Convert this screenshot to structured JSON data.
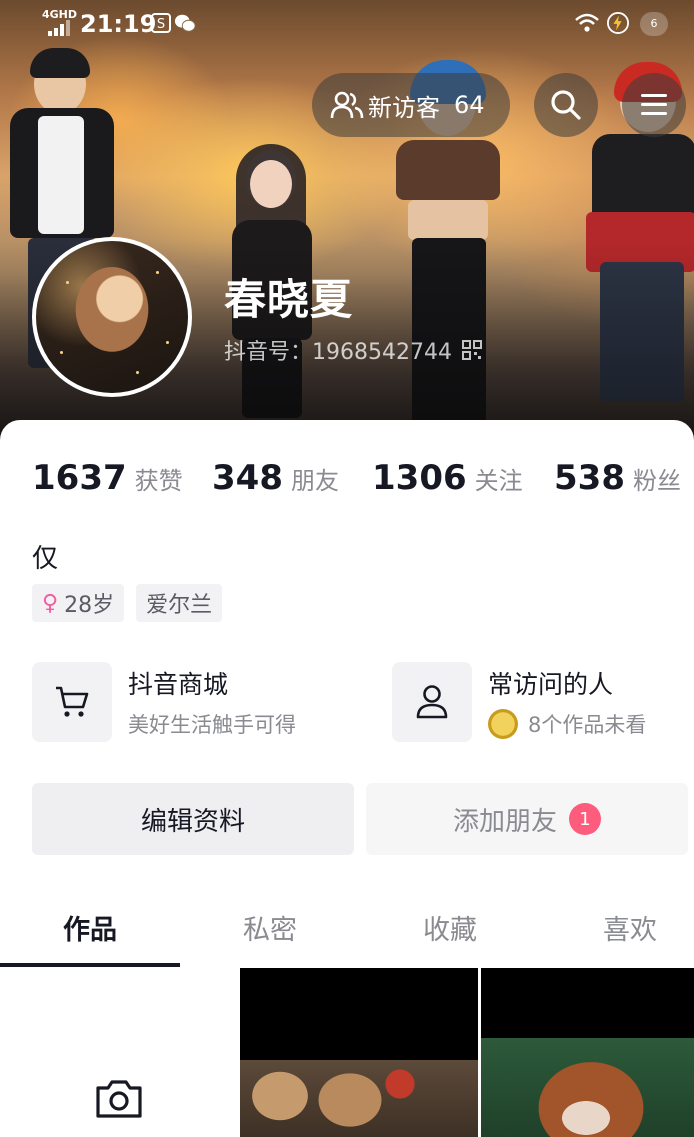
{
  "status_bar": {
    "network": "4GHD",
    "time": "21:19",
    "battery_badge": "6",
    "icons": [
      "signal-icon",
      "soul-app-icon",
      "wechat-icon",
      "wifi-icon",
      "charging-icon"
    ]
  },
  "header": {
    "visitor_label": "新访客",
    "visitor_count": "64",
    "nickname": "春晓夏",
    "douyin_id": "抖音号：1968542744"
  },
  "stats": [
    {
      "num": "1637",
      "label": "获赞"
    },
    {
      "num": "348",
      "label": "朋友"
    },
    {
      "num": "1306",
      "label": "关注"
    },
    {
      "num": "538",
      "label": "粉丝"
    }
  ],
  "profile": {
    "bio": "仅",
    "tags": [
      {
        "icon": "female-icon",
        "symbol": "♀",
        "text": "28岁"
      },
      {
        "text": "爱尔兰"
      }
    ]
  },
  "shortcuts": {
    "mall": {
      "title": "抖音商城",
      "subtitle": "美好生活触手可得"
    },
    "visitors": {
      "title": "常访问的人",
      "subtitle": "8个作品未看"
    }
  },
  "actions": {
    "edit_label": "编辑资料",
    "add_friend_label": "添加朋友",
    "add_friend_badge": "1"
  },
  "tabs": [
    {
      "label": "作品",
      "active": true
    },
    {
      "label": "私密",
      "active": false
    },
    {
      "label": "收藏",
      "active": false
    },
    {
      "label": "喜欢",
      "active": false
    }
  ],
  "colors": {
    "text_primary": "#161823",
    "text_secondary": "#8a8b91",
    "badge_red": "#fe5c7c",
    "female_pink": "#f15ea3"
  }
}
